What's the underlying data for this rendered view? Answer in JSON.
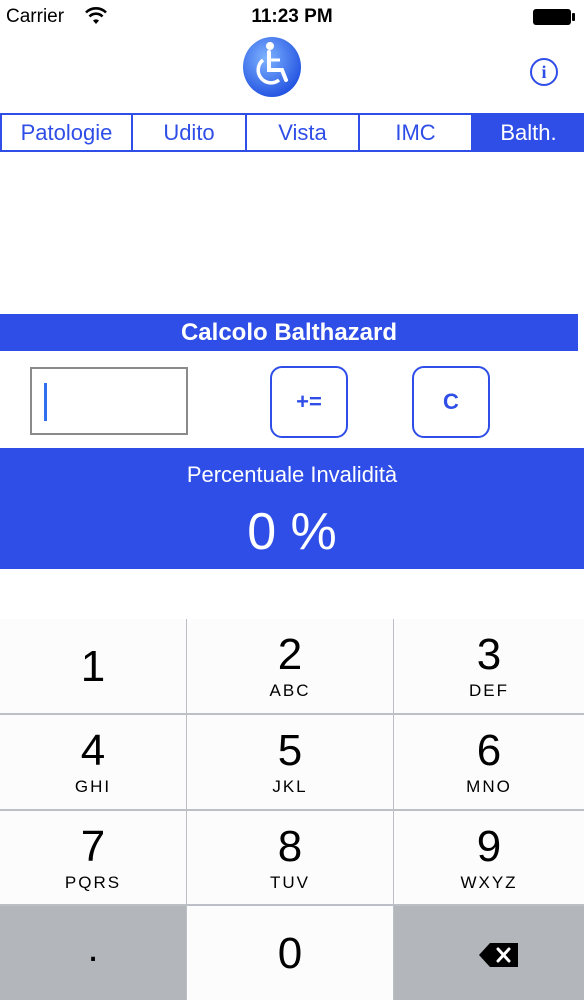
{
  "status_bar": {
    "carrier": "Carrier",
    "time": "11:23 PM",
    "wifi_icon": "wifi-icon",
    "battery_icon": "battery-icon"
  },
  "header": {
    "logo_icon": "wheelchair-logo-icon",
    "info_label": "i"
  },
  "tabs": [
    {
      "label": "Patologie",
      "selected": false
    },
    {
      "label": "Udito",
      "selected": false
    },
    {
      "label": "Vista",
      "selected": false
    },
    {
      "label": "IMC",
      "selected": false
    },
    {
      "label": "Balth.",
      "selected": true
    }
  ],
  "calculator": {
    "title": "Calcolo Balthazard",
    "input_value": "",
    "add_button_label": "+=",
    "clear_button_label": "C"
  },
  "result": {
    "label": "Percentuale Invalidità",
    "value": "0 %"
  },
  "keypad": {
    "keys": [
      {
        "digit": "1",
        "letters": ""
      },
      {
        "digit": "2",
        "letters": "ABC"
      },
      {
        "digit": "3",
        "letters": "DEF"
      },
      {
        "digit": "4",
        "letters": "GHI"
      },
      {
        "digit": "5",
        "letters": "JKL"
      },
      {
        "digit": "6",
        "letters": "MNO"
      },
      {
        "digit": "7",
        "letters": "PQRS"
      },
      {
        "digit": "8",
        "letters": "TUV"
      },
      {
        "digit": "9",
        "letters": "WXYZ"
      },
      {
        "digit": ".",
        "letters": ""
      },
      {
        "digit": "0",
        "letters": ""
      },
      {
        "digit": "",
        "letters": "",
        "icon": "backspace-icon"
      }
    ]
  },
  "colors": {
    "accent": "#2f4ee8",
    "keypad_background": "#bcc0c6",
    "key_light": "#fcfcfd",
    "key_dark": "#b3b7bc"
  }
}
